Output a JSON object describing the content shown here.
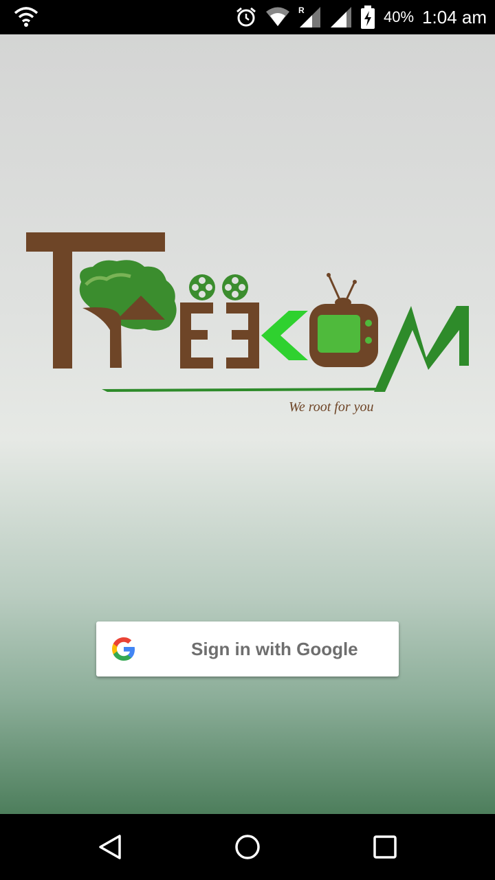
{
  "status_bar": {
    "battery_percent": "40%",
    "time": "1:04 am",
    "icons": [
      "wifi-icon",
      "alarm-icon",
      "wifi-signal-icon",
      "roaming-signal-icon",
      "cell-signal-icon",
      "battery-charging-icon"
    ]
  },
  "logo": {
    "tagline": "We root for you",
    "colors": {
      "brown": "#6e4527",
      "dark_green": "#2e8b2a",
      "bright_green": "#2fd12f",
      "tree_green": "#3b8d2e"
    }
  },
  "signin": {
    "label": "Sign in with Google",
    "icon": "google-g-icon"
  },
  "nav_bar": {
    "icons": [
      "back-icon",
      "home-icon",
      "recents-icon"
    ]
  }
}
